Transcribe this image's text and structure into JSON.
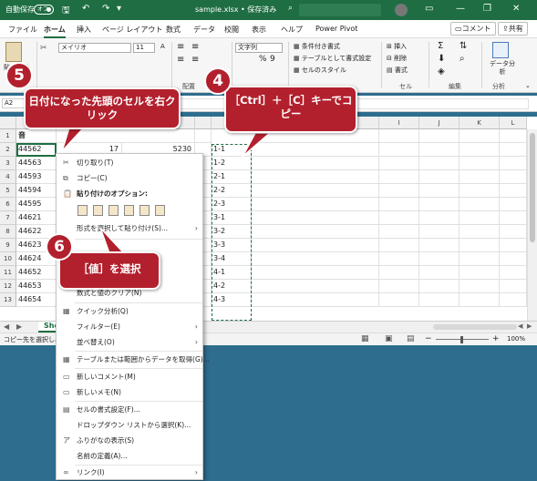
{
  "titlebar": {
    "autosave_label": "自動保存",
    "autosave_state": "オフ",
    "doc_title": "sample.xlsx • 保存済み"
  },
  "tabs": [
    "ファイル",
    "ホーム",
    "挿入",
    "ページ レイアウト",
    "数式",
    "データ",
    "校閲",
    "表示",
    "ヘルプ",
    "Power Pivot"
  ],
  "active_tab": "ホーム",
  "tab_actions": {
    "comment": "コメント",
    "share": "共有"
  },
  "ribbon": {
    "paste_label": "貼り付け",
    "font_name": "メイリオ",
    "font_size": "11",
    "number_format": "文字列",
    "cond_format": "条件付き書式",
    "table_format": "テーブルとして書式設定",
    "cell_style": "セルのスタイル",
    "insert": "挿入",
    "delete": "削除",
    "format": "書式",
    "data_analysis": "データ分析",
    "group_align": "配置",
    "group_cells": "セル",
    "group_edit": "編集",
    "group_analysis": "分析"
  },
  "formula_bar": {
    "name_box": "A2"
  },
  "columns": [
    "I",
    "J",
    "K",
    "L"
  ],
  "row_numbers": [
    "1",
    "2",
    "3",
    "4",
    "5",
    "6",
    "7",
    "8",
    "9",
    "10",
    "11",
    "12",
    "13"
  ],
  "header_row": {
    "a1": "音"
  },
  "col_a": [
    "44562",
    "44563",
    "44593",
    "44594",
    "44595",
    "44621",
    "44622",
    "44623",
    "44624",
    "44652",
    "44653",
    "44654"
  ],
  "row2": {
    "b2": "17",
    "c2": "5230"
  },
  "col_d": [
    "1-1",
    "1-2",
    "2-1",
    "2-2",
    "2-3",
    "3-1",
    "3-2",
    "3-3",
    "3-4",
    "4-1",
    "4-2",
    "4-3"
  ],
  "sheet_tab": "She",
  "status": {
    "message": "コピー先を選択し、E",
    "zoom": "100%"
  },
  "context_menu": {
    "cut": "切り取り(T)",
    "copy": "コピー(C)",
    "paste_options": "貼り付けのオプション:",
    "paste_special": "形式を選択して貼り付け(S)...",
    "clear": "数式と値のクリア(N)",
    "quick_analysis": "クイック分析(Q)",
    "filter": "フィルター(E)",
    "sort": "並べ替え(O)",
    "from_table": "テーブルまたは範囲からデータを取得(G)...",
    "new_comment": "新しいコメント(M)",
    "new_note": "新しいメモ(N)",
    "format_cells": "セルの書式設定(F)...",
    "dropdown": "ドロップダウン リストから選択(K)...",
    "phonetic": "ふりがなの表示(S)",
    "define_name": "名前の定義(A)...",
    "link": "リンク(I)",
    "phonetic_glyph": "ア"
  },
  "callouts": {
    "step5_num": "5",
    "step5_text": "日付になった先頭のセルを右クリック",
    "step4_num": "4",
    "step4_text": "［Ctrl］＋［C］キーでコピー",
    "step6_num": "6",
    "step6_text": "［値］を選択"
  },
  "colors": {
    "excel_green": "#1f6e43",
    "callout_red": "#b2202d",
    "background": "#2e6d8e"
  }
}
